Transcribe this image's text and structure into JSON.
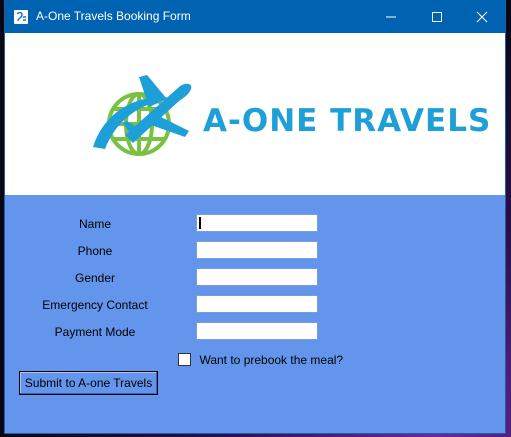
{
  "window": {
    "title": "A-One Travels Booking Form",
    "controls": [
      "minimize-icon",
      "maximize-icon",
      "close-icon"
    ]
  },
  "banner": {
    "logo_text": "A-ONE TRAVELS",
    "colors": {
      "brand_blue": "#1e9fd8",
      "globe_green": "#7ac143"
    }
  },
  "form": {
    "fields": [
      {
        "label": "Name",
        "value": ""
      },
      {
        "label": "Phone",
        "value": ""
      },
      {
        "label": "Gender",
        "value": ""
      },
      {
        "label": "Emergency Contact",
        "value": ""
      },
      {
        "label": "Payment Mode",
        "value": ""
      }
    ],
    "meal_checkbox": {
      "label": "Want to prebook the meal?",
      "checked": false
    },
    "submit_label": "Submit to A-one Travels"
  },
  "colors": {
    "titlebar": "#0063b1",
    "form_bg": "#6495ed"
  }
}
